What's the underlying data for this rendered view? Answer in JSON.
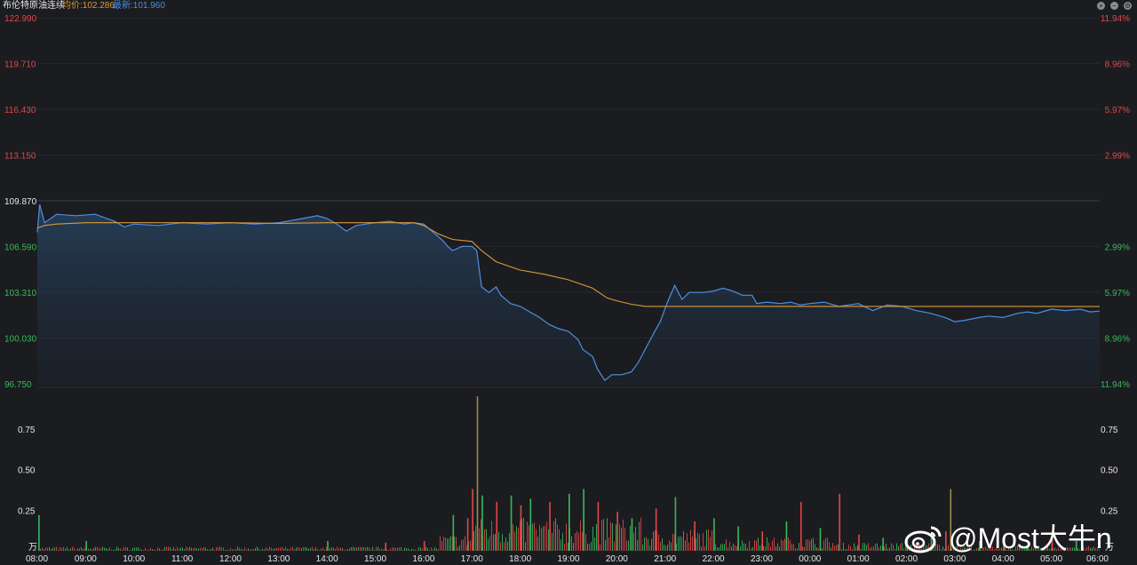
{
  "header": {
    "title": "布伦特原油连续",
    "avg_label": "均价:102.286",
    "last_label": "最新:101.960"
  },
  "colors": {
    "price_line": "#4f8ee3",
    "avg_line": "#d99a3a",
    "up_text": "#e04848",
    "down_text": "#39b95a",
    "neutral_text": "#e6e6e6",
    "vol_up": "#e04848",
    "vol_down": "#39b95a",
    "vol_spike": "#9a8a4a"
  },
  "icons": [
    "plus-circle-icon",
    "minus-circle-icon",
    "gear-icon",
    "weibo-logo-icon"
  ],
  "watermark": "@Most大牛n",
  "chart_data": [
    {
      "type": "line",
      "title": "",
      "prev_close": 109.87,
      "ylim": [
        96.75,
        122.99
      ],
      "y_ticks": [
        {
          "value": 122.99,
          "label": "122.990",
          "pct": "11.94%",
          "dir": "up"
        },
        {
          "value": 119.71,
          "label": "119.710",
          "pct": "8.96%",
          "dir": "up"
        },
        {
          "value": 116.43,
          "label": "116.430",
          "pct": "5.97%",
          "dir": "up"
        },
        {
          "value": 113.15,
          "label": "113.150",
          "pct": "2.99%",
          "dir": "up"
        },
        {
          "value": 109.87,
          "label": "109.870",
          "pct": "",
          "dir": "flat"
        },
        {
          "value": 106.59,
          "label": "106.590",
          "pct": "2.99%",
          "dir": "down"
        },
        {
          "value": 103.31,
          "label": "103.310",
          "pct": "5.97%",
          "dir": "down"
        },
        {
          "value": 100.03,
          "label": "100.030",
          "pct": "8.96%",
          "dir": "down"
        },
        {
          "value": 96.75,
          "label": "96.750",
          "pct": "11.94%",
          "dir": "down"
        }
      ],
      "x_ticks": [
        "08:00",
        "09:00",
        "10:00",
        "11:00",
        "12:00",
        "13:00",
        "14:00",
        "15:00",
        "16:00",
        "17:00",
        "18:00",
        "19:00",
        "20:00",
        "21:00",
        "22:00",
        "23:00",
        "00:00",
        "01:00",
        "02:00",
        "03:00",
        "04:00",
        "05:00",
        "06:00"
      ],
      "x_range_hours": [
        0,
        22
      ],
      "series": [
        {
          "name": "最新",
          "points": [
            [
              0,
              107.6
            ],
            [
              0.05,
              109.6
            ],
            [
              0.15,
              108.3
            ],
            [
              0.4,
              108.9
            ],
            [
              0.8,
              108.8
            ],
            [
              1.2,
              108.9
            ],
            [
              1.6,
              108.4
            ],
            [
              1.8,
              108.0
            ],
            [
              2.0,
              108.2
            ],
            [
              2.5,
              108.1
            ],
            [
              3.0,
              108.3
            ],
            [
              3.5,
              108.2
            ],
            [
              4.0,
              108.3
            ],
            [
              4.5,
              108.2
            ],
            [
              5.0,
              108.3
            ],
            [
              5.5,
              108.6
            ],
            [
              5.8,
              108.8
            ],
            [
              6.0,
              108.6
            ],
            [
              6.2,
              108.2
            ],
            [
              6.4,
              107.7
            ],
            [
              6.6,
              108.1
            ],
            [
              7.0,
              108.3
            ],
            [
              7.3,
              108.4
            ],
            [
              7.6,
              108.2
            ],
            [
              7.8,
              108.3
            ],
            [
              8.0,
              108.2
            ],
            [
              8.2,
              107.6
            ],
            [
              8.4,
              107.0
            ],
            [
              8.5,
              106.6
            ],
            [
              8.6,
              106.3
            ],
            [
              8.8,
              106.6
            ],
            [
              9.0,
              106.6
            ],
            [
              9.1,
              106.3
            ],
            [
              9.2,
              103.7
            ],
            [
              9.35,
              103.3
            ],
            [
              9.5,
              103.7
            ],
            [
              9.6,
              103.1
            ],
            [
              9.8,
              102.5
            ],
            [
              10.0,
              102.3
            ],
            [
              10.2,
              101.9
            ],
            [
              10.4,
              101.5
            ],
            [
              10.6,
              101.0
            ],
            [
              10.8,
              100.7
            ],
            [
              11.0,
              100.5
            ],
            [
              11.2,
              99.9
            ],
            [
              11.3,
              99.2
            ],
            [
              11.5,
              98.7
            ],
            [
              11.6,
              97.8
            ],
            [
              11.75,
              97.0
            ],
            [
              11.9,
              97.4
            ],
            [
              12.1,
              97.4
            ],
            [
              12.3,
              97.6
            ],
            [
              12.45,
              98.3
            ],
            [
              12.6,
              99.3
            ],
            [
              12.8,
              100.6
            ],
            [
              12.9,
              101.2
            ],
            [
              13.05,
              102.6
            ],
            [
              13.2,
              103.8
            ],
            [
              13.35,
              102.8
            ],
            [
              13.5,
              103.3
            ],
            [
              13.8,
              103.3
            ],
            [
              14.0,
              103.4
            ],
            [
              14.2,
              103.6
            ],
            [
              14.4,
              103.4
            ],
            [
              14.6,
              103.1
            ],
            [
              14.8,
              103.1
            ],
            [
              14.9,
              102.5
            ],
            [
              15.1,
              102.6
            ],
            [
              15.4,
              102.5
            ],
            [
              15.6,
              102.6
            ],
            [
              15.8,
              102.4
            ],
            [
              16.0,
              102.5
            ],
            [
              16.3,
              102.6
            ],
            [
              16.6,
              102.3
            ],
            [
              16.8,
              102.4
            ],
            [
              17.0,
              102.5
            ],
            [
              17.3,
              102.0
            ],
            [
              17.6,
              102.4
            ],
            [
              17.9,
              102.3
            ],
            [
              18.2,
              102.0
            ],
            [
              18.5,
              101.8
            ],
            [
              18.8,
              101.5
            ],
            [
              19.0,
              101.2
            ],
            [
              19.2,
              101.3
            ],
            [
              19.5,
              101.5
            ],
            [
              19.7,
              101.6
            ],
            [
              20.0,
              101.5
            ],
            [
              20.3,
              101.8
            ],
            [
              20.5,
              101.9
            ],
            [
              20.7,
              101.8
            ],
            [
              21.0,
              102.1
            ],
            [
              21.3,
              102.0
            ],
            [
              21.6,
              102.1
            ],
            [
              21.8,
              101.9
            ],
            [
              22.0,
              101.96
            ]
          ]
        },
        {
          "name": "均价",
          "points": [
            [
              0,
              107.9
            ],
            [
              0.15,
              108.1
            ],
            [
              0.4,
              108.2
            ],
            [
              1,
              108.3
            ],
            [
              2,
              108.3
            ],
            [
              3,
              108.3
            ],
            [
              4,
              108.3
            ],
            [
              5,
              108.25
            ],
            [
              6,
              108.3
            ],
            [
              7,
              108.3
            ],
            [
              7.8,
              108.3
            ],
            [
              8.0,
              108.1
            ],
            [
              8.3,
              107.5
            ],
            [
              8.6,
              107.1
            ],
            [
              9.0,
              106.95
            ],
            [
              9.2,
              106.3
            ],
            [
              9.5,
              105.5
            ],
            [
              10.0,
              104.9
            ],
            [
              10.5,
              104.6
            ],
            [
              11.0,
              104.2
            ],
            [
              11.5,
              103.6
            ],
            [
              11.8,
              102.9
            ],
            [
              12.0,
              102.7
            ],
            [
              12.3,
              102.45
            ],
            [
              12.6,
              102.3
            ],
            [
              13.0,
              102.3
            ],
            [
              14.0,
              102.3
            ],
            [
              15.0,
              102.3
            ],
            [
              16.0,
              102.3
            ],
            [
              17.0,
              102.3
            ],
            [
              18.0,
              102.3
            ],
            [
              19.0,
              102.3
            ],
            [
              20.0,
              102.3
            ],
            [
              21.0,
              102.3
            ],
            [
              22.0,
              102.286
            ]
          ]
        }
      ]
    },
    {
      "type": "bar",
      "title": "",
      "unit_label": "万",
      "ylim": [
        0,
        1.0
      ],
      "y_ticks": [
        {
          "value": 0.75,
          "label": "0.75"
        },
        {
          "value": 0.5,
          "label": "0.50"
        },
        {
          "value": 0.25,
          "label": "0.25"
        }
      ],
      "spikes": [
        [
          0.02,
          0.22,
          "down"
        ],
        [
          1.0,
          0.06,
          "down"
        ],
        [
          6.0,
          0.06,
          "down"
        ],
        [
          7.2,
          0.05,
          "up"
        ],
        [
          8.0,
          0.06,
          "up"
        ],
        [
          8.6,
          0.22,
          "down"
        ],
        [
          8.9,
          0.2,
          "up"
        ],
        [
          9.0,
          0.38,
          "up"
        ],
        [
          9.1,
          0.95,
          "spike"
        ],
        [
          9.2,
          0.34,
          "down"
        ],
        [
          9.5,
          0.3,
          "up"
        ],
        [
          9.8,
          0.34,
          "down"
        ],
        [
          10.0,
          0.28,
          "up"
        ],
        [
          10.2,
          0.32,
          "down"
        ],
        [
          10.6,
          0.3,
          "up"
        ],
        [
          11.0,
          0.35,
          "down"
        ],
        [
          11.3,
          0.38,
          "down"
        ],
        [
          11.6,
          0.3,
          "up"
        ],
        [
          12.0,
          0.24,
          "up"
        ],
        [
          12.3,
          0.2,
          "down"
        ],
        [
          12.8,
          0.26,
          "up"
        ],
        [
          13.2,
          0.33,
          "down"
        ],
        [
          13.6,
          0.18,
          "up"
        ],
        [
          14.0,
          0.2,
          "down"
        ],
        [
          14.5,
          0.15,
          "down"
        ],
        [
          15.0,
          0.12,
          "up"
        ],
        [
          15.5,
          0.18,
          "down"
        ],
        [
          15.8,
          0.3,
          "up"
        ],
        [
          16.2,
          0.14,
          "down"
        ],
        [
          16.6,
          0.35,
          "up"
        ],
        [
          17.0,
          0.1,
          "up"
        ],
        [
          17.5,
          0.08,
          "down"
        ],
        [
          18.0,
          0.08,
          "down"
        ],
        [
          18.5,
          0.08,
          "down"
        ],
        [
          18.8,
          0.12,
          "up"
        ],
        [
          18.9,
          0.38,
          "spike"
        ],
        [
          19.5,
          0.06,
          "down"
        ],
        [
          20.0,
          0.07,
          "up"
        ],
        [
          20.5,
          0.06,
          "down"
        ],
        [
          21.0,
          0.08,
          "up"
        ],
        [
          21.5,
          0.06,
          "down"
        ]
      ]
    }
  ]
}
